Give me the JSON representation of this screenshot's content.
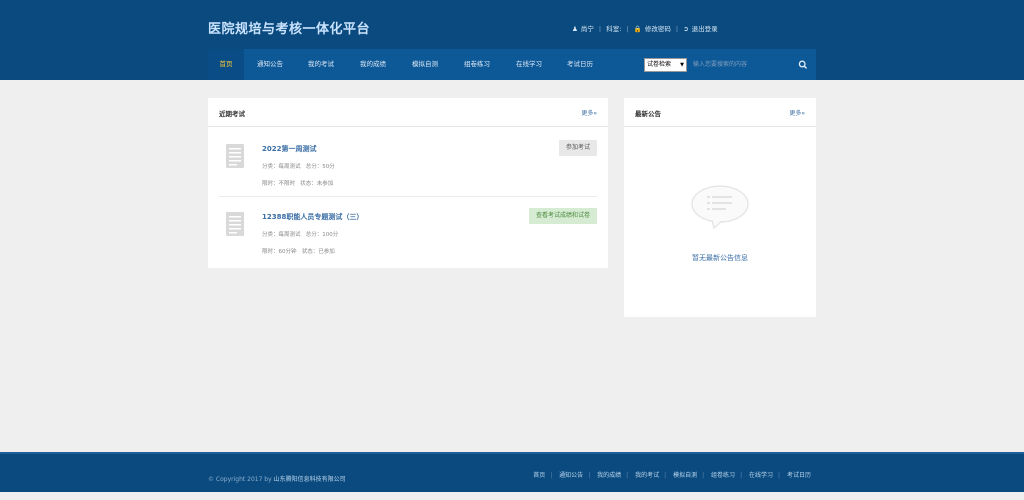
{
  "header": {
    "title": "医院规培与考核一体化平台",
    "user": {
      "username": "尚宁",
      "department_label": "科室:",
      "change_password": "修改密码",
      "logout": "退出登录"
    }
  },
  "nav": {
    "items": [
      {
        "label": "首页",
        "active": true
      },
      {
        "label": "通知公告"
      },
      {
        "label": "我的考试"
      },
      {
        "label": "我的成绩"
      },
      {
        "label": "模拟自测"
      },
      {
        "label": "组卷练习"
      },
      {
        "label": "在线学习"
      },
      {
        "label": "考试日历"
      }
    ],
    "search": {
      "select_value": "试卷检索",
      "placeholder": "输入您要搜索的内容"
    }
  },
  "recent_exams": {
    "title": "近期考试",
    "more": "更多»",
    "items": [
      {
        "name": "2022第一周测试",
        "category": "分类：每周测试",
        "total": "总分：50分",
        "time_limit": "限时：不限时",
        "status": "状态：未参加",
        "action": "参加考试"
      },
      {
        "name": "12388职能人员专题测试（三）",
        "category": "分类：每周测试",
        "total": "总分：100分",
        "time_limit": "限时：60分钟",
        "status": "状态：已参加",
        "action": "查看考试成绩和试卷"
      }
    ]
  },
  "announcements": {
    "title": "最新公告",
    "more": "更多»",
    "empty_text": "暂无最新公告信息"
  },
  "footer": {
    "copyright": "© Copyright 2017 by",
    "company": "山东腾阳信息科技有限公司",
    "links": [
      "首页",
      "通知公告",
      "我的成绩",
      "我的考试",
      "模拟自测",
      "组卷练习",
      "在线学习",
      "考试日历"
    ]
  },
  "colors": {
    "header_bg": "#0a4a7e",
    "nav_bg": "#0d5897",
    "active_nav": "#ffcc33",
    "link_blue": "#3a6ea5",
    "success_green": "#d6ecd2"
  }
}
